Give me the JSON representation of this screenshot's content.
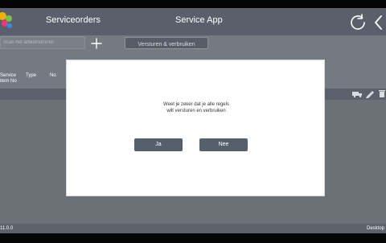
{
  "header": {
    "section_title": "Serviceorders",
    "app_title": "Service App"
  },
  "toolbar": {
    "search_placeholder": "Scan het artikelnummer",
    "send_button": "Versturen & verbruiken"
  },
  "table": {
    "columns": [
      {
        "label": "Service\nitem No"
      },
      {
        "label": "Type"
      },
      {
        "label": "No"
      }
    ]
  },
  "dialog": {
    "message_line1": "Weet je zeker dat je alle regels",
    "message_line2": "wilt versturen en verbruiken",
    "yes_label": "Ja",
    "no_label": "Nee"
  },
  "status": {
    "version": "11.0.0",
    "device": "Desktop"
  },
  "icons": {
    "logo": "app-logo",
    "refresh": "refresh-icon",
    "back": "back-icon",
    "add": "add-icon",
    "row_tools": [
      "truck-icon",
      "edit-icon",
      "delete-icon"
    ]
  },
  "colors": {
    "header": "#59606b",
    "toolbar": "#747a82",
    "content": "#6c7178",
    "modal_button": "#56606d",
    "modal_bg": "#ffffff"
  }
}
